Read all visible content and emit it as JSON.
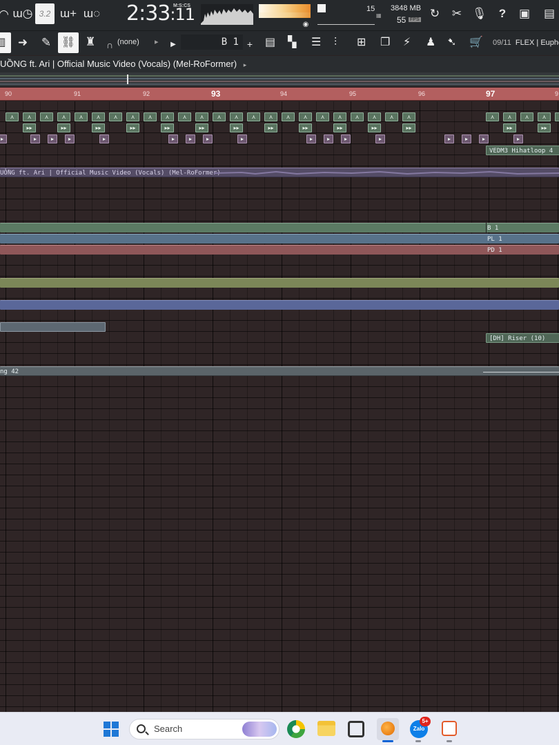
{
  "toolbar": {
    "time_main": "2:33",
    "time_sub": ":11",
    "time_mode": "M:S:CS",
    "cpu_value": "15",
    "memory": "3848 MB",
    "fps_value": "55",
    "fps_label": "FPS",
    "tempo_box": "3.2"
  },
  "toolbar2": {
    "snap": "(none)",
    "pattern": "B 1",
    "plus": "+",
    "news_counter": "09/11",
    "news_text": "FLEX | Eupho"
  },
  "title": {
    "text": "UỒNG ft. Ari  |  Official Music Video (Vocals) (Mel-RoFormer)"
  },
  "ruler": {
    "bars": [
      "90",
      "91",
      "92",
      "93",
      "94",
      "95",
      "96",
      "97",
      "9"
    ]
  },
  "clips": {
    "hihat": "VEDM3 Hihatloop 4",
    "audio": "UỒNG ft. Ari  |  Official Music Video (Vocals) (Mel-RoFormer)",
    "b1": "B 1",
    "pl1": "PL 1",
    "pd1": "PD 1",
    "riser": "[DH] Riser (10)",
    "song": "ng 42"
  },
  "taskbar": {
    "search_label": "Search",
    "zalo_badge": "5+",
    "zalo_label": "Zalo"
  },
  "colors": {
    "ruler": "#b35f5f",
    "grid_bg": "#2f2526",
    "pattern_green": "#5b7a63",
    "pattern_blue": "#58728a",
    "pattern_red": "#8f5759",
    "olive": "#7c8758",
    "indigo": "#5a6799",
    "taskbar": "#e9ebf4"
  }
}
